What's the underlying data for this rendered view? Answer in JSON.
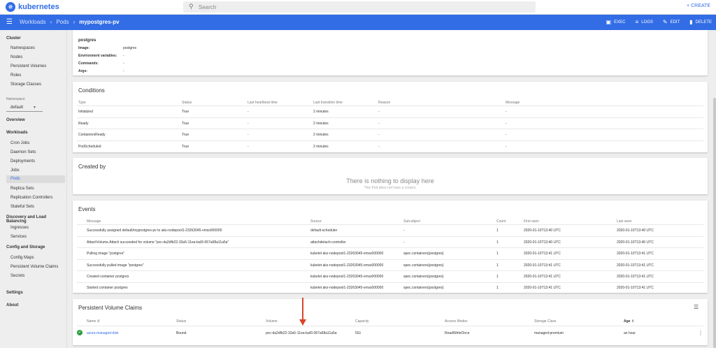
{
  "app": {
    "title": "kubernetes"
  },
  "search": {
    "placeholder": "Search"
  },
  "topbar": {
    "create_label": "CREATE"
  },
  "breadcrumb": [
    "Workloads",
    "Pods",
    "mypostgres-pv"
  ],
  "actions": [
    {
      "label": "EXEC",
      "icon": "terminal-icon"
    },
    {
      "label": "LOGS",
      "icon": "logs-icon"
    },
    {
      "label": "EDIT",
      "icon": "edit-icon"
    },
    {
      "label": "DELETE",
      "icon": "delete-icon"
    }
  ],
  "sidebar": {
    "cluster": {
      "title": "Cluster",
      "items": [
        "Namespaces",
        "Nodes",
        "Persistent Volumes",
        "Roles",
        "Storage Classes"
      ]
    },
    "namespace": {
      "label": "Namespace",
      "value": "default"
    },
    "overview": "Overview",
    "workloads": {
      "title": "Workloads",
      "items": [
        "Cron Jobs",
        "Daemon Sets",
        "Deployments",
        "Jobs",
        "Pods",
        "Replica Sets",
        "Replication Controllers",
        "Stateful Sets"
      ]
    },
    "discovery": {
      "title": "Discovery and Load Balancing",
      "items": [
        "Ingresses",
        "Services"
      ]
    },
    "config": {
      "title": "Config and Storage",
      "items": [
        "Config Maps",
        "Persistent Volume Claims",
        "Secrets"
      ]
    },
    "settings": "Settings",
    "about": "About"
  },
  "container": {
    "name": "postgres",
    "rows": [
      {
        "label": "Image:",
        "value": "postgres"
      },
      {
        "label": "Environment variables:",
        "value": "-"
      },
      {
        "label": "Commands:",
        "value": "-"
      },
      {
        "label": "Args:",
        "value": "-"
      }
    ]
  },
  "conditions": {
    "title": "Conditions",
    "headers": [
      "Type",
      "Status",
      "Last heartbeat time",
      "Last transition time",
      "Reason",
      "Message"
    ],
    "rows": [
      [
        "Initialized",
        "True",
        "-",
        "2 minutes",
        "-",
        "-"
      ],
      [
        "Ready",
        "True",
        "-",
        "2 minutes",
        "-",
        "-"
      ],
      [
        "ContainersReady",
        "True",
        "-",
        "2 minutes",
        "-",
        "-"
      ],
      [
        "PodScheduled",
        "True",
        "-",
        "2 minutes",
        "-",
        "-"
      ]
    ]
  },
  "created_by": {
    "title": "Created by",
    "empty_title": "There is nothing to display here",
    "empty_sub": "This Pod does not have a creator."
  },
  "events": {
    "title": "Events",
    "headers": [
      "Message",
      "Source",
      "Sub-object",
      "Count",
      "First seen",
      "Last seen"
    ],
    "rows": [
      [
        "Successfully assigned default/mypostgres-pv to aks-nodepool1-23263045-vmss000000",
        "default-scheduler",
        "-",
        "1",
        "2020-01-10T13:40 UTC",
        "2020-01-10T13:40 UTC"
      ],
      [
        "AttachVolume.Attach succeeded for volume \"pvc-da2dfb22-33a5-11ea-baf3-067a68a11a5a\"",
        "attachdetach-controller",
        "-",
        "1",
        "2020-01-10T13:40 UTC",
        "2020-01-10T13:40 UTC"
      ],
      [
        "Pulling image \"postgres\"",
        "kubelet aks-nodepool1-23263045-vmss000000",
        "spec.containers{postgres}",
        "1",
        "2020-01-10T13:41 UTC",
        "2020-01-10T13:41 UTC"
      ],
      [
        "Successfully pulled image \"postgres\"",
        "kubelet aks-nodepool1-23263045-vmss000000",
        "spec.containers{postgres}",
        "1",
        "2020-01-10T13:41 UTC",
        "2020-01-10T13:41 UTC"
      ],
      [
        "Created container postgres",
        "kubelet aks-nodepool1-23263045-vmss000000",
        "spec.containers{postgres}",
        "1",
        "2020-01-10T13:41 UTC",
        "2020-01-10T13:41 UTC"
      ],
      [
        "Started container postgres",
        "kubelet aks-nodepool1-23263045-vmss000000",
        "spec.containers{postgres}",
        "1",
        "2020-01-10T13:41 UTC",
        "2020-01-10T13:41 UTC"
      ]
    ]
  },
  "pvc": {
    "title": "Persistent Volume Claims",
    "headers": [
      "Name",
      "Status",
      "Volume",
      "Capacity",
      "Access Modes",
      "Storage Class",
      "Age"
    ],
    "row": [
      "azure-managed-disk",
      "Bound",
      "pvc-da2dfb22-33a5-11ea-baf3-067a68a11a5a",
      "5Gi",
      "ReadWriteOnce",
      "managed-premium",
      "an hour"
    ]
  },
  "colors": {
    "brand": "#326de6",
    "success": "#2e9e41",
    "annotation_arrow": "#d9452b"
  }
}
